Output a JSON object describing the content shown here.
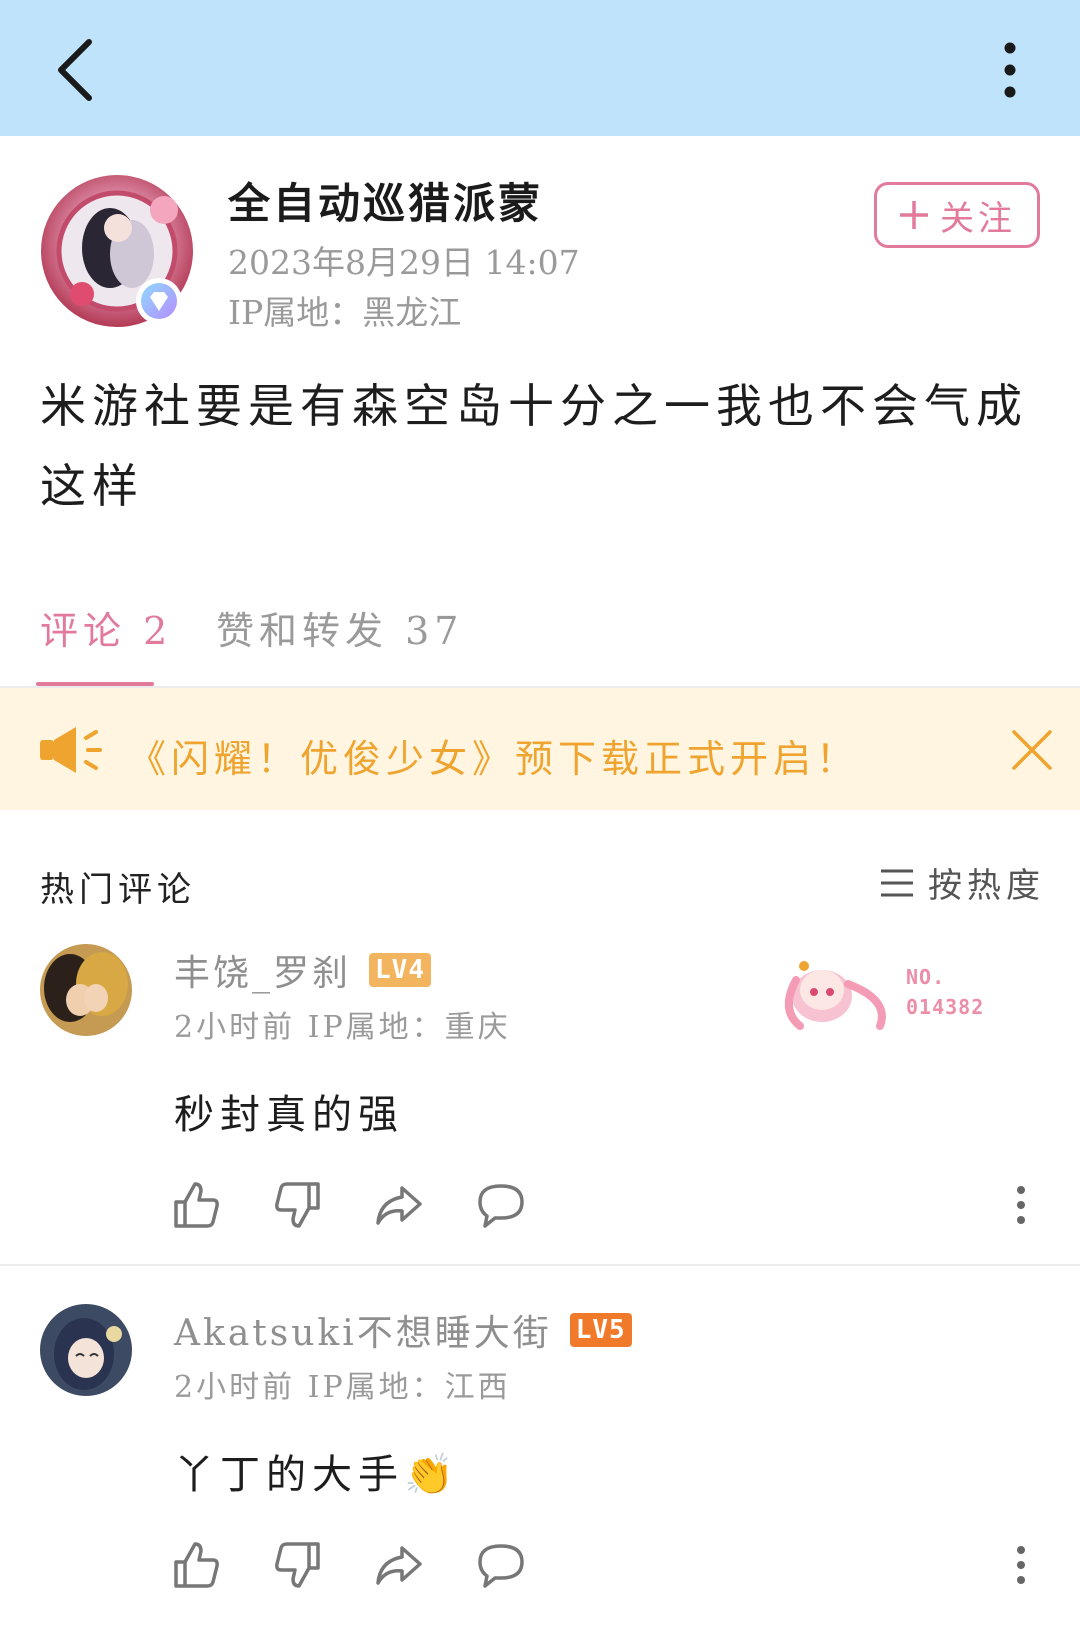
{
  "post": {
    "author_name": "全自动巡猎派蒙",
    "timestamp": "2023年8月29日 14:07",
    "ip_location": "IP属地：黑龙江",
    "follow_label": "关注",
    "text": "米游社要是有森空岛十分之一我也不会气成这样"
  },
  "tabs": {
    "comments_label": "评论 2",
    "likes_label": "赞和转发 37"
  },
  "notice": {
    "text": "《闪耀！优俊少女》预下载正式开启！"
  },
  "comments_section": {
    "title": "热门评论",
    "sort_label": "按热度"
  },
  "comments": [
    {
      "username": "丰饶_罗刹",
      "level": "LV4",
      "level_color": "#f3b460",
      "meta": "2小时前  IP属地：重庆",
      "text": "秒封真的强",
      "decoration_number": "NO.\n014382"
    },
    {
      "username": "Akatsuki不想睡大街",
      "level": "LV5",
      "level_color": "#f07a2a",
      "meta": "2小时前  IP属地：江西",
      "text": "丫丁的大手👏"
    }
  ],
  "colors": {
    "topbar": "#bfe3fb",
    "accent_pink": "#e27a9c",
    "notice_bg": "#fff5e0",
    "notice_text": "#f0a430"
  },
  "icons": [
    "back-icon",
    "more-vertical-icon",
    "plus-icon",
    "verified-icon",
    "megaphone-icon",
    "close-icon",
    "sort-list-icon",
    "thumb-up-icon",
    "thumb-down-icon",
    "share-icon",
    "comment-icon"
  ]
}
